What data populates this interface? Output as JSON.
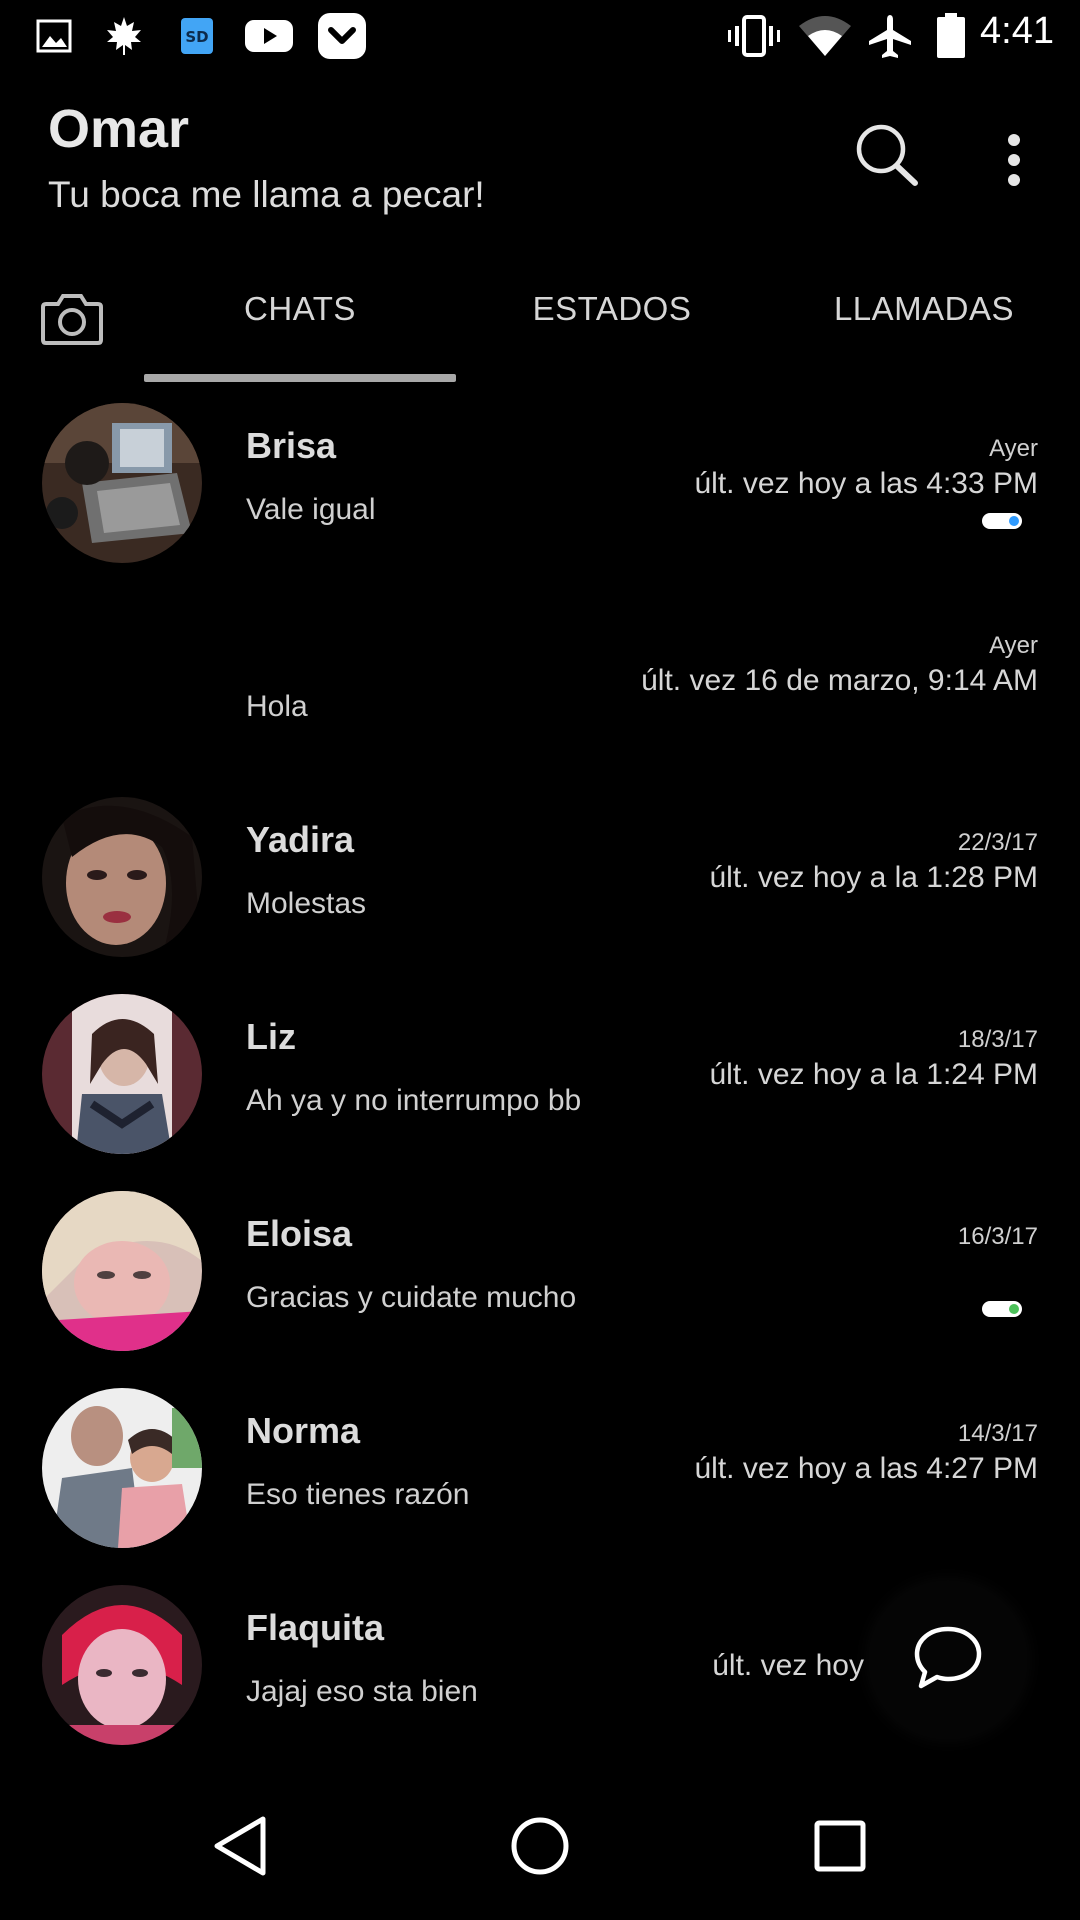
{
  "status_bar": {
    "time": "4:41",
    "left_icons": [
      "gallery-icon",
      "leaf-icon",
      "sd-card-icon",
      "youtube-icon",
      "pocket-icon"
    ],
    "right_icons": [
      "vibrate-icon",
      "wifi-icon",
      "airplane-icon",
      "battery-icon"
    ],
    "sd_label": "SD"
  },
  "header": {
    "title": "Omar",
    "subtitle": "Tu boca me llama a pecar!",
    "actions": [
      "search-icon",
      "more-vert-icon"
    ]
  },
  "tabs": {
    "camera_icon": "camera-icon",
    "items": [
      {
        "label": "CHATS",
        "active": true
      },
      {
        "label": "ESTADOS",
        "active": false
      },
      {
        "label": "LLAMADAS",
        "active": false
      }
    ]
  },
  "chats": [
    {
      "name": "Brisa",
      "message": "Vale igual",
      "date": "Ayer",
      "seen": "últ. vez hoy a las 4:33 PM",
      "indicator": "#2f9bff"
    },
    {
      "name": "",
      "message": "Hola",
      "date": "Ayer",
      "seen": "últ. vez 16 de marzo, 9:14 AM",
      "indicator": null
    },
    {
      "name": "Yadira",
      "message": "Molestas",
      "date": "22/3/17",
      "seen": "últ. vez hoy a la 1:28 PM",
      "indicator": null
    },
    {
      "name": "Liz",
      "message": "Ah ya y no interrumpo bb",
      "date": "18/3/17",
      "seen": "últ. vez hoy a la 1:24 PM",
      "indicator": null
    },
    {
      "name": "Eloisa",
      "message": "Gracias y cuidate mucho",
      "date": "16/3/17",
      "seen": "",
      "indicator": "#4cc15a"
    },
    {
      "name": "Norma",
      "message": "Eso tienes razón",
      "date": "14/3/17",
      "seen": "últ. vez hoy a las 4:27 PM",
      "indicator": null
    },
    {
      "name": "Flaquita",
      "message": "Jajaj eso sta bien",
      "date": "",
      "seen": "últ. vez hoy",
      "indicator": null
    }
  ],
  "fab": {
    "icon": "new-chat-icon"
  },
  "nav": {
    "icons": [
      "back-icon",
      "home-icon",
      "recents-icon"
    ]
  }
}
